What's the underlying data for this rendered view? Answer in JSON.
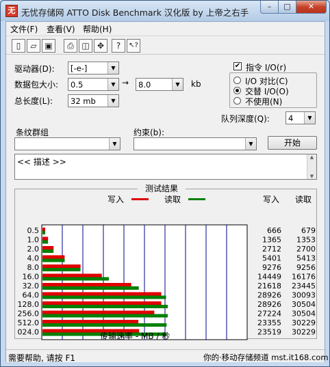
{
  "window": {
    "title": "无忧存储网 ATTO Disk Benchmark 汉化版 by 上帝之右手",
    "icon_label": "无",
    "minimize_glyph": "–",
    "maximize_glyph": "□",
    "close_glyph": "✕"
  },
  "menu": [
    {
      "label": "文件(F)"
    },
    {
      "label": "查看(V)"
    },
    {
      "label": "帮助(H)"
    }
  ],
  "toolbar": {
    "buttons": [
      {
        "icon": "new-document-icon",
        "glyph": "▯"
      },
      {
        "icon": "open-folder-icon",
        "glyph": "▱"
      },
      {
        "icon": "save-icon",
        "glyph": "▣"
      },
      {
        "icon": "print-icon",
        "glyph": "⎙"
      },
      {
        "icon": "print-preview-icon",
        "glyph": "◫"
      },
      {
        "icon": "move-icon",
        "glyph": "✥"
      },
      {
        "icon": "help-icon",
        "glyph": "?"
      },
      {
        "icon": "context-help-icon",
        "glyph": "↖?"
      }
    ]
  },
  "settings": {
    "drive_label": "驱动器(D):",
    "drive_value": "[-e-]",
    "packet_size_label": "数据包大小:",
    "packet_from": "0.5",
    "packet_arrow": "→",
    "packet_to": "8.0",
    "packet_unit": "kb",
    "total_length_label": "总长度(L):",
    "total_length_value": "32 mb",
    "command_io_label": "指令 I/O(r)",
    "command_io_checked": true,
    "io_compare_label": "I/O 对比(C)",
    "overlap_io_label": "交替 I/O(O)",
    "neither_label": "不使用(N)",
    "selected_mode": "overlap",
    "queue_depth_label": "队列深度(Q):",
    "queue_depth_value": "4",
    "stripe_group_label": "条纹群组",
    "stripe_group_value": "",
    "constraint_label": "约束(b):",
    "constraint_value": "",
    "start_button": "开始",
    "description_text": "<< 描述 >>"
  },
  "results": {
    "group_title": "测试结果",
    "legend_write": "写入",
    "legend_read": "读取",
    "write_color": "#e00000",
    "read_color": "#008000",
    "col_write_header": "写入",
    "col_read_header": "读取",
    "x_axis_label": "传输速率 - MB / 秒"
  },
  "chart_data": {
    "type": "bar",
    "orientation": "horizontal",
    "categories": [
      "0.5",
      "1.0",
      "2.0",
      "4.0",
      "8.0",
      "16.0",
      "32.0",
      "64.0",
      "128.0",
      "256.0",
      "512.0",
      "024.0"
    ],
    "series": [
      {
        "name": "写入",
        "values": [
          0.666,
          1.365,
          2.712,
          5.401,
          9.276,
          14.449,
          21.618,
          28.926,
          28.926,
          27.224,
          23.355,
          23.519
        ]
      },
      {
        "name": "读取",
        "values": [
          0.679,
          1.353,
          2.7,
          5.413,
          9.256,
          16.176,
          23.445,
          30.093,
          30.504,
          30.504,
          30.229,
          30.229
        ]
      }
    ],
    "table": {
      "write": [
        "666",
        "1365",
        "2712",
        "5401",
        "9276",
        "14449",
        "21618",
        "28926",
        "28926",
        "27224",
        "23355",
        "23519"
      ],
      "read": [
        "679",
        "1353",
        "2700",
        "5413",
        "9256",
        "16176",
        "23445",
        "30093",
        "30504",
        "30504",
        "30229",
        "30229"
      ]
    },
    "xlim": [
      0,
      50
    ],
    "x_ticks": [
      "0",
      "5",
      "10",
      "15",
      "20",
      "25",
      "30",
      "35",
      "40",
      "45",
      "50"
    ],
    "xlabel": "传输速率 - MB / 秒",
    "legend": "top"
  },
  "status": {
    "help_text": "需要帮助, 请按 F1",
    "watermark": "你的·移动存储频道 mst.it168.com"
  }
}
